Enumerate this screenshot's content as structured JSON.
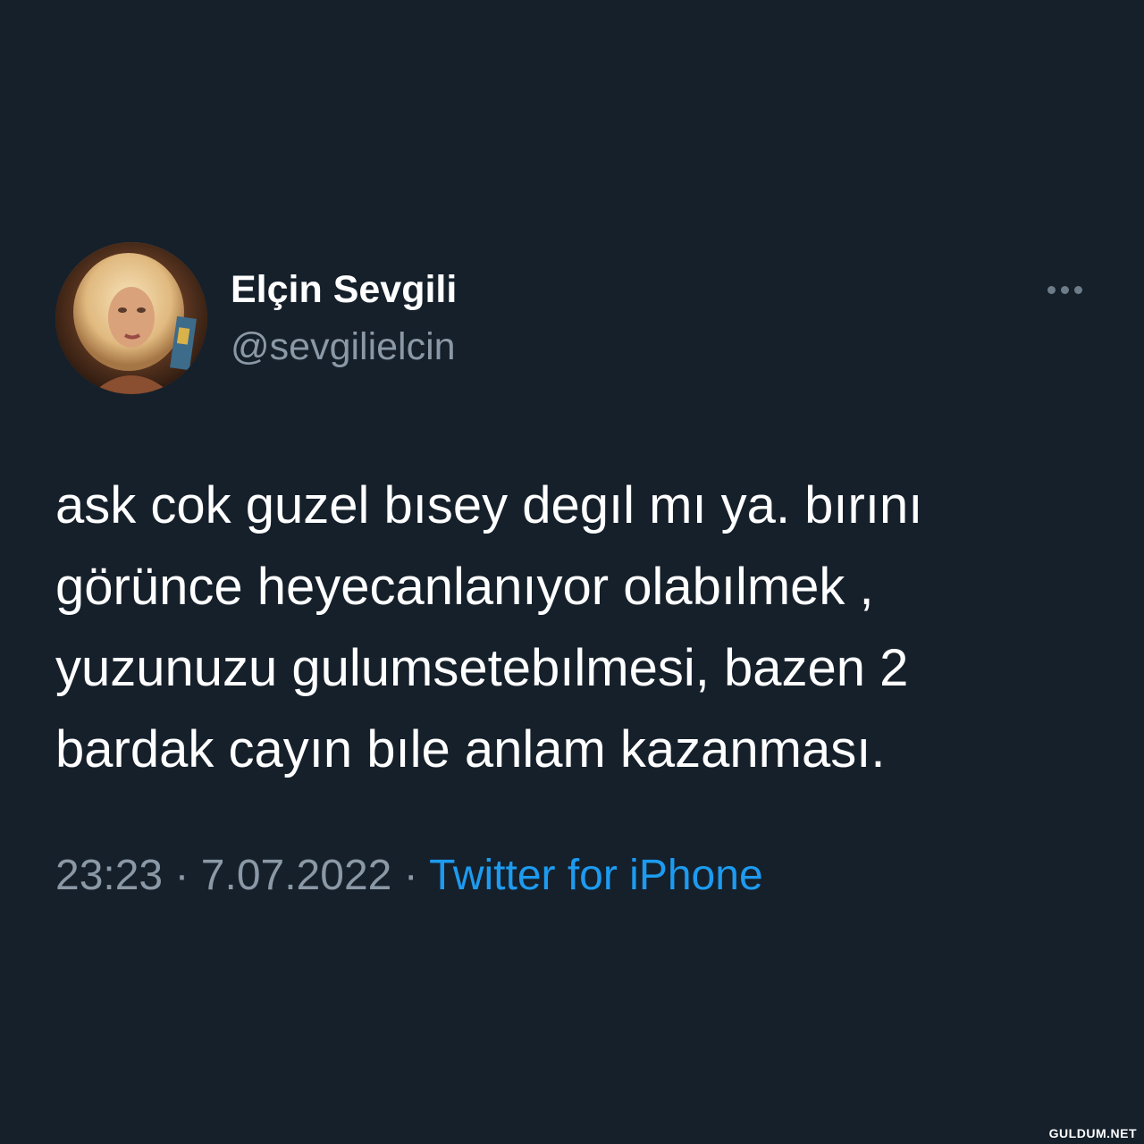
{
  "tweet": {
    "author": {
      "display_name": "Elçin Sevgili",
      "handle": "@sevgilielcin"
    },
    "text_lines": [
      "ask cok guzel bısey degıl mı ya. bırını",
      "görünce heyecanlanıyor olabılmek ,",
      "yuzunuzu gulumsetebılmesi, bazen 2",
      "bardak cayın bıle anlam kazanması."
    ],
    "time": "23:23",
    "separator": "·",
    "date": "7.07.2022",
    "source": "Twitter for iPhone"
  },
  "watermark": "GULDUM.NET",
  "icons": {
    "more": "more-horizontal-icon"
  },
  "colors": {
    "background": "#15202b",
    "primary_text": "#ffffff",
    "secondary_text": "#8b98a5",
    "link": "#1d9bf0"
  }
}
